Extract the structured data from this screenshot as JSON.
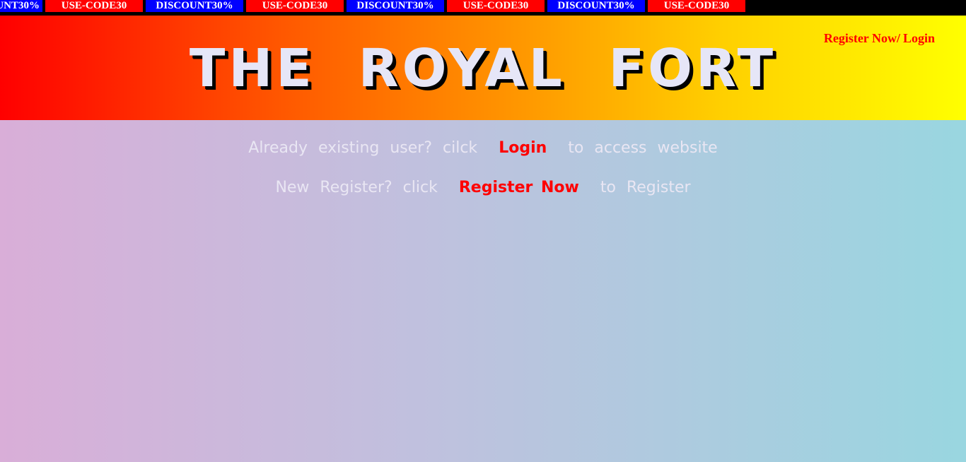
{
  "ticker": {
    "items": [
      {
        "text": "UNT30%",
        "color": "#0000ff"
      },
      {
        "text": "USE-CODE30",
        "color": "#ff0000"
      },
      {
        "text": "DISCOUNT30%",
        "color": "#0000ff"
      },
      {
        "text": "USE-CODE30",
        "color": "#ff0000"
      },
      {
        "text": "DISCOUNT30%",
        "color": "#0000ff"
      },
      {
        "text": "USE-CODE30",
        "color": "#ff0000"
      },
      {
        "text": "DISCOUNT30%",
        "color": "#0000ff"
      },
      {
        "text": "USE-CODE30",
        "color": "#ff0000"
      }
    ]
  },
  "header": {
    "title": "THE ROYAL FORT",
    "register_link": "Register Now/",
    "login_link": "Login"
  },
  "messages": {
    "existing_prefix": "Already existing user? cilck",
    "existing_link": "Login",
    "existing_suffix": "to access website",
    "new_prefix": "New Register? click",
    "new_link": "Register Now",
    "new_suffix": "to Register"
  },
  "colors": {
    "link_red": "#ff0000",
    "promo_blue": "#0000ff",
    "promo_red": "#ff0000"
  }
}
